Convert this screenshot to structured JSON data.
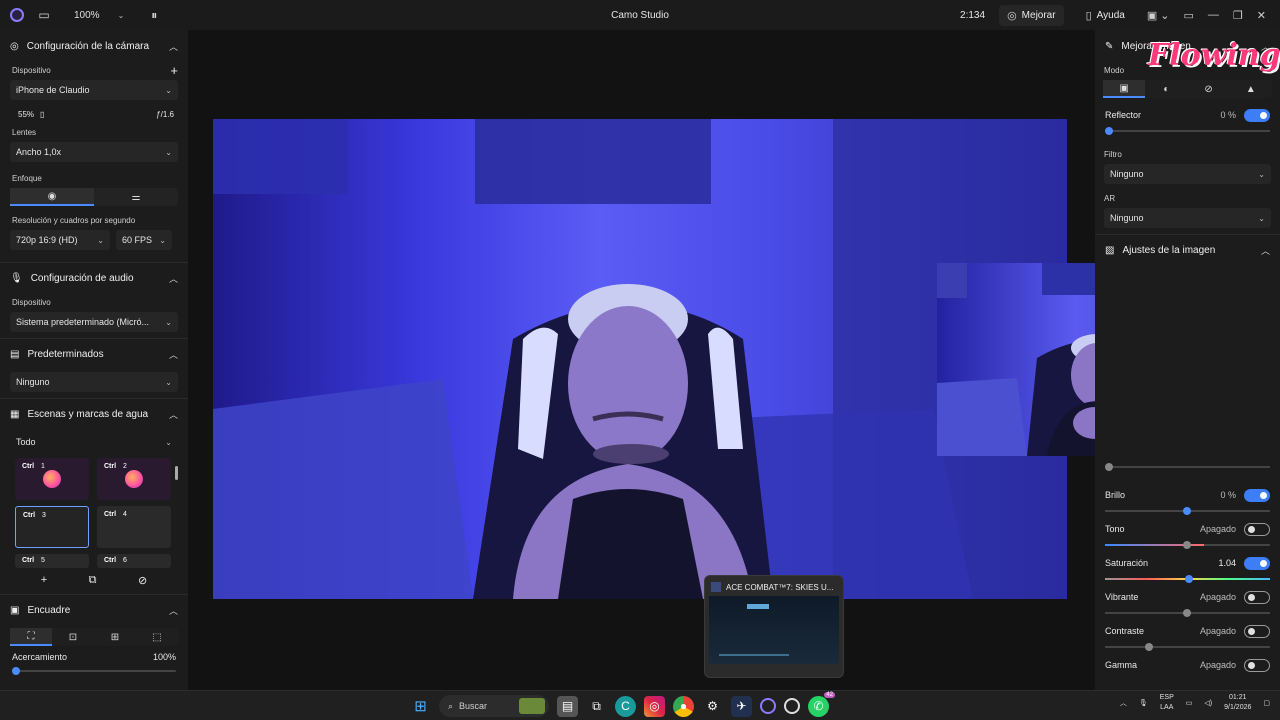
{
  "titlebar": {
    "zoom": "100%",
    "title": "Camo Studio",
    "timer": "2:134",
    "enhance_label": "Mejorar",
    "help_label": "Ayuda"
  },
  "camera": {
    "header": "Configuración de la cámara",
    "device_label": "Dispositivo",
    "device_value": "iPhone de Claudio",
    "battery": "55%",
    "aperture": "ƒ/1.6",
    "lens_label": "Lentes",
    "lens_value": "Ancho 1,0x",
    "focus_label": "Enfoque",
    "res_label": "Resolución y cuadros por segundo",
    "res_value": "720p 16:9 (HD)",
    "fps_value": "60 FPS"
  },
  "audio": {
    "header": "Configuración de audio",
    "device_label": "Dispositivo",
    "device_value": "Sistema predeterminado (Micró..."
  },
  "presets": {
    "header": "Predeterminados",
    "value": "Ninguno"
  },
  "scenes": {
    "header": "Escenas y marcas de agua",
    "filter": "Todo",
    "items": [
      {
        "ctl": "Ctrl",
        "num": "1"
      },
      {
        "ctl": "Ctrl",
        "num": "2"
      },
      {
        "ctl": "Ctrl",
        "num": "3"
      },
      {
        "ctl": "Ctrl",
        "num": "4"
      },
      {
        "ctl": "Ctrl",
        "num": "5"
      },
      {
        "ctl": "Ctrl",
        "num": "6"
      }
    ]
  },
  "framing": {
    "header": "Encuadre",
    "zoom_label": "Acercamiento",
    "zoom_value": "100%"
  },
  "right": {
    "enhance_header": "Mejorar imagen",
    "mode_label": "Modo",
    "reflector_label": "Reflector",
    "reflector_value": "0 %",
    "filter_label": "Filtro",
    "filter_value": "Ninguno",
    "ar_label": "AR",
    "ar_value": "Ninguno",
    "image_header": "Ajustes de la imagen",
    "brightness_label": "Brillo",
    "brightness_value": "0 %",
    "tone_label": "Tono",
    "tone_value": "Apagado",
    "saturation_label": "Saturación",
    "saturation_value": "1.04",
    "vibrance_label": "Vibrante",
    "vibrance_value": "Apagado",
    "contrast_label": "Contraste",
    "contrast_value": "Apagado",
    "gamma_label": "Gamma",
    "gamma_value": "Apagado"
  },
  "overlay": {
    "logo_text": "Flowing"
  },
  "preview_popup": {
    "title": "ACE COMBAT™7: SKIES U..."
  },
  "taskbar": {
    "search_label": "Buscar",
    "lang_top": "ESP",
    "lang_bottom": "LAA",
    "time": "01:21",
    "date": "9/1/2026",
    "badge": "42"
  },
  "colors": {
    "accent": "#4a8bff",
    "brand": "#8b7bff",
    "logo": "#ff3a7a"
  }
}
